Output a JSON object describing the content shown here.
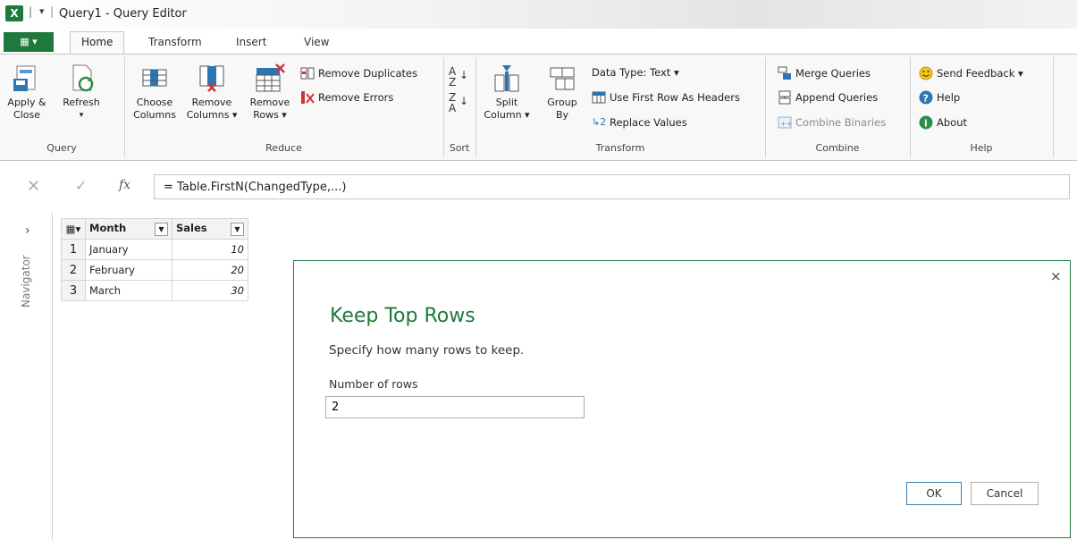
{
  "title_bar": {
    "app_icon": "X",
    "window_title": "Query1 - Query Editor"
  },
  "ribbon_tabs": {
    "file": "▦ ▾",
    "tabs": [
      "Home",
      "Transform",
      "Insert",
      "View"
    ]
  },
  "ribbon": {
    "query": {
      "label": "Query",
      "apply_close": [
        "Apply &",
        "Close"
      ],
      "refresh": [
        "Refresh",
        "▾"
      ]
    },
    "reduce": {
      "label": "Reduce",
      "choose_columns": [
        "Choose",
        "Columns"
      ],
      "remove_columns": [
        "Remove",
        "Columns ▾"
      ],
      "remove_rows": [
        "Remove",
        "Rows ▾"
      ],
      "remove_duplicates": "Remove Duplicates",
      "remove_errors": "Remove Errors"
    },
    "sort": {
      "label": "Sort"
    },
    "transform": {
      "label": "Transform",
      "split_column": [
        "Split",
        "Column ▾"
      ],
      "group_by": [
        "Group",
        "By"
      ],
      "data_type": "Data Type: Text ▾",
      "use_first_row": "Use First Row As Headers",
      "replace_values": "Replace Values"
    },
    "combine": {
      "label": "Combine",
      "merge_queries": "Merge Queries",
      "append_queries": "Append Queries",
      "combine_binaries": "Combine Binaries"
    },
    "help": {
      "label": "Help",
      "send_feedback": "Send Feedback ▾",
      "help": "Help",
      "about": "About"
    }
  },
  "formula_bar": {
    "cancel": "✕",
    "confirm": "✓",
    "fx": "fx",
    "formula": "= Table.FirstN(ChangedType,...)"
  },
  "navigator": {
    "label": "Navigator",
    "arrow": "›"
  },
  "grid": {
    "columns": [
      "Month",
      "Sales"
    ],
    "rows": [
      {
        "n": "1",
        "month": "January",
        "sales": "10"
      },
      {
        "n": "2",
        "month": "February",
        "sales": "20"
      },
      {
        "n": "3",
        "month": "March",
        "sales": "30"
      }
    ]
  },
  "dialog": {
    "close": "×",
    "title": "Keep Top Rows",
    "description": "Specify how many rows to keep.",
    "field_label": "Number of rows",
    "field_value": "2",
    "ok": "OK",
    "cancel": "Cancel"
  },
  "colors": {
    "accent": "#1e7a3c",
    "button_focus": "#3c7fb1"
  }
}
